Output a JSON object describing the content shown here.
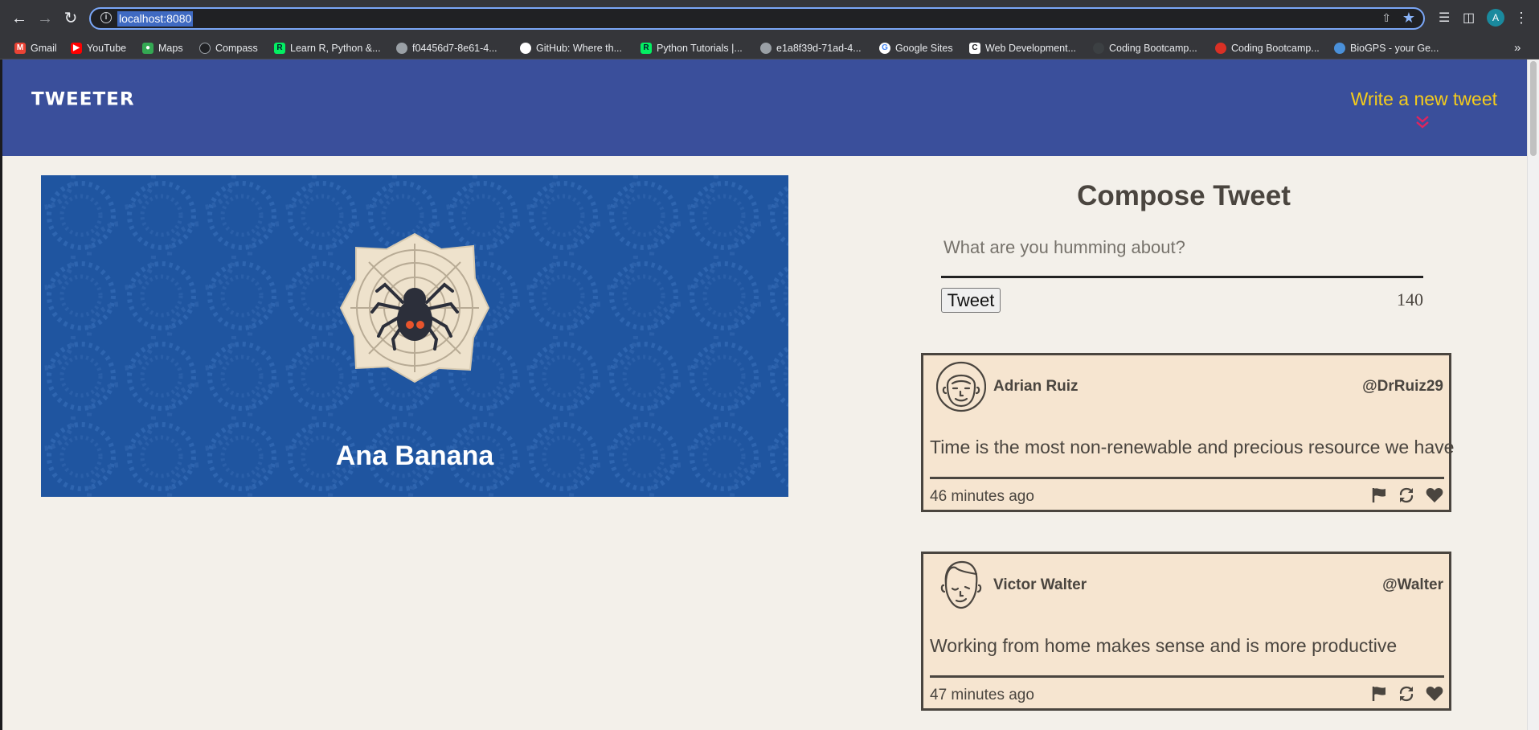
{
  "browser": {
    "url": "localhost:8080",
    "profile_initial": "A",
    "bookmarks": [
      {
        "label": "Gmail",
        "icon": "gmail-icon",
        "color": "#ea4335"
      },
      {
        "label": "YouTube",
        "icon": "youtube-icon",
        "color": "#ff0000"
      },
      {
        "label": "Maps",
        "icon": "maps-icon",
        "color": "#34a853"
      },
      {
        "label": "Compass",
        "icon": "compass-icon",
        "color": "#5f6368"
      },
      {
        "label": "Learn R, Python &...",
        "icon": "datacamp-icon",
        "color": "#03ef62"
      },
      {
        "label": "f04456d7-8e61-4...",
        "icon": "globe-icon",
        "color": "#9aa0a6"
      },
      {
        "label": "GitHub: Where th...",
        "icon": "github-icon",
        "color": "#ffffff"
      },
      {
        "label": "Python Tutorials |...",
        "icon": "datacamp-icon",
        "color": "#03ef62"
      },
      {
        "label": "e1a8f39d-71ad-4...",
        "icon": "globe-icon",
        "color": "#9aa0a6"
      },
      {
        "label": "Google Sites",
        "icon": "google-icon",
        "color": "#4285f4"
      },
      {
        "label": "Web Development...",
        "icon": "cf-icon",
        "color": "#ffffff"
      },
      {
        "label": "Coding Bootcamp...",
        "icon": "bootcamp-icon",
        "color": "#3c4043"
      },
      {
        "label": "Coding Bootcamp...",
        "icon": "bootcamp-red-icon",
        "color": "#d93025"
      },
      {
        "label": "BioGPS - your Ge...",
        "icon": "biogps-icon",
        "color": "#4a90d9"
      }
    ]
  },
  "nav": {
    "logo": "TWEETER",
    "write_link": "Write a new tweet",
    "accent_color": "#f5cc1b",
    "chevron_color": "#e0245e"
  },
  "profile": {
    "name": "Ana Banana",
    "avatar_icon": "spider-web-icon",
    "background_color": "#1f55a0"
  },
  "compose": {
    "title": "Compose Tweet",
    "placeholder": "What are you humming about?",
    "button_label": "Tweet",
    "counter": "140"
  },
  "tweets": [
    {
      "name": "Adrian Ruiz",
      "handle": "@DrRuiz29",
      "content": "Time is the most non-renewable and precious resource we have",
      "time": "46 minutes ago"
    },
    {
      "name": "Victor Walter",
      "handle": "@Walter",
      "content": "Working from home makes sense and is more productive",
      "time": "47 minutes ago"
    }
  ],
  "colors": {
    "nav_bg": "#3a4f9b",
    "page_bg": "#f3f0ea",
    "tweet_bg": "#f6e5d0",
    "text": "#4a453f"
  }
}
